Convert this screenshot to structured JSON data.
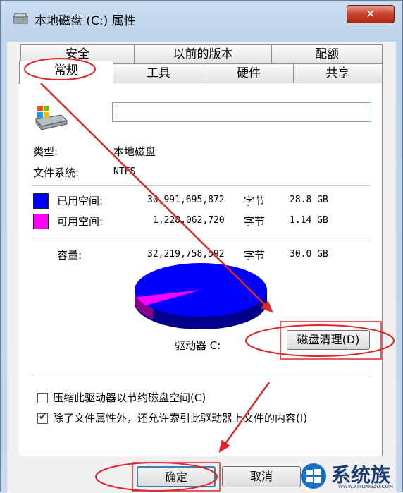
{
  "window": {
    "title": "本地磁盘 (C:) 属性",
    "close_label": "✕"
  },
  "tabs": {
    "row1": [
      "安全",
      "以前的版本",
      "配额"
    ],
    "row2": [
      "常规",
      "工具",
      "硬件",
      "共享"
    ],
    "active": "常规"
  },
  "general": {
    "drive_name_value": "",
    "type_label": "类型:",
    "type_value": "本地磁盘",
    "fs_label": "文件系统:",
    "fs_value": "NTFS",
    "used": {
      "label": "已用空间:",
      "bytes": "30,991,695,872",
      "unit": "字节",
      "size": "28.8 GB",
      "color": "#0000ff"
    },
    "free": {
      "label": "可用空间:",
      "bytes": "1,228,062,720",
      "unit": "字节",
      "size": "1.14 GB",
      "color": "#ff00ff"
    },
    "capacity": {
      "label": "容量:",
      "bytes": "32,219,758,592",
      "unit": "字节",
      "size": "30.0 GB"
    },
    "drive_label": "驱动器 C:",
    "cleanup_button": "磁盘清理(D)",
    "compress_label": "压缩此驱动器以节约磁盘空间(C)",
    "compress_checked": false,
    "index_label": "除了文件属性外，还允许索引此驱动器上文件的内容(I)",
    "index_checked": true
  },
  "footer": {
    "ok": "确定",
    "cancel": "取消"
  },
  "watermark": {
    "brand": "系统族",
    "url": "WWW.XITONGZU.COM"
  },
  "annotation_color": "#e0262b"
}
